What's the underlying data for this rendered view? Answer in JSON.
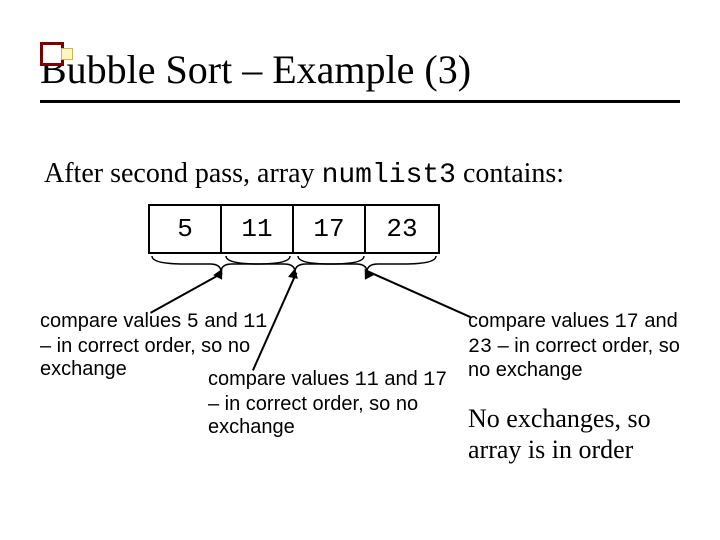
{
  "title": "Bubble Sort – Example (3)",
  "body": {
    "prefix": "After second pass, array ",
    "arrayName": "numlist3",
    "suffix": " contains:"
  },
  "array": [
    "5",
    "11",
    "17",
    "23"
  ],
  "captions": {
    "c1": {
      "t1": "compare values ",
      "v1": "5",
      "t2": " and ",
      "v2": "11",
      "t3": " –  in correct order, so no exchange"
    },
    "c2": {
      "t1": "compare values ",
      "v1": "11",
      "t2": " and ",
      "v2": "17",
      "t3": " – in correct order, so no exchange"
    },
    "c3": {
      "t1": "compare values ",
      "v1": "17",
      "t2": " and ",
      "v2": "23",
      "t3": " – in correct order, so no exchange"
    }
  },
  "conclusion": "No exchanges, so array is in order",
  "chart_data": {
    "type": "table",
    "title": "numlist3 after second pass",
    "values": [
      5,
      11,
      17,
      23
    ],
    "comparisons": [
      {
        "a": 5,
        "b": 11,
        "swap": false
      },
      {
        "a": 11,
        "b": 17,
        "swap": false
      },
      {
        "a": 17,
        "b": 23,
        "swap": false
      }
    ],
    "result": "sorted"
  }
}
